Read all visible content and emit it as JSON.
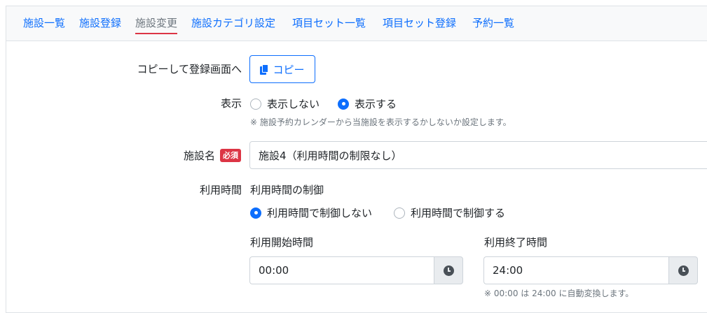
{
  "tabs": [
    {
      "label": "施設一覧",
      "active": false
    },
    {
      "label": "施設登録",
      "active": false
    },
    {
      "label": "施設変更",
      "active": true
    },
    {
      "label": "施設カテゴリ設定",
      "active": false
    },
    {
      "label": "項目セット一覧",
      "active": false
    },
    {
      "label": "項目セット登録",
      "active": false
    },
    {
      "label": "予約一覧",
      "active": false
    }
  ],
  "copy_row": {
    "label": "コピーして登録画面へ",
    "button": "コピー",
    "icon": "copy-icon"
  },
  "display_row": {
    "label": "表示",
    "options": [
      {
        "label": "表示しない",
        "checked": false
      },
      {
        "label": "表示する",
        "checked": true
      }
    ],
    "note": "※ 施設予約カレンダーから当施設を表示するかしないか設定します。"
  },
  "name_row": {
    "label": "施設名",
    "badge": "必須",
    "value": "施設4（利用時間の制限なし）"
  },
  "time_row": {
    "label": "利用時間",
    "subheading": "利用時間の制御",
    "options": [
      {
        "label": "利用時間で制御しない",
        "checked": true
      },
      {
        "label": "利用時間で制御する",
        "checked": false
      }
    ],
    "start_label": "利用開始時間",
    "start_value": "00:00",
    "end_label": "利用終了時間",
    "end_value": "24:00",
    "note": "※ 00:00 は 24:00 に自動変換します。",
    "icon": "clock-icon"
  },
  "colors": {
    "link": "#0d6efd",
    "active_underline": "#dc3545",
    "badge": "#dc3545"
  }
}
